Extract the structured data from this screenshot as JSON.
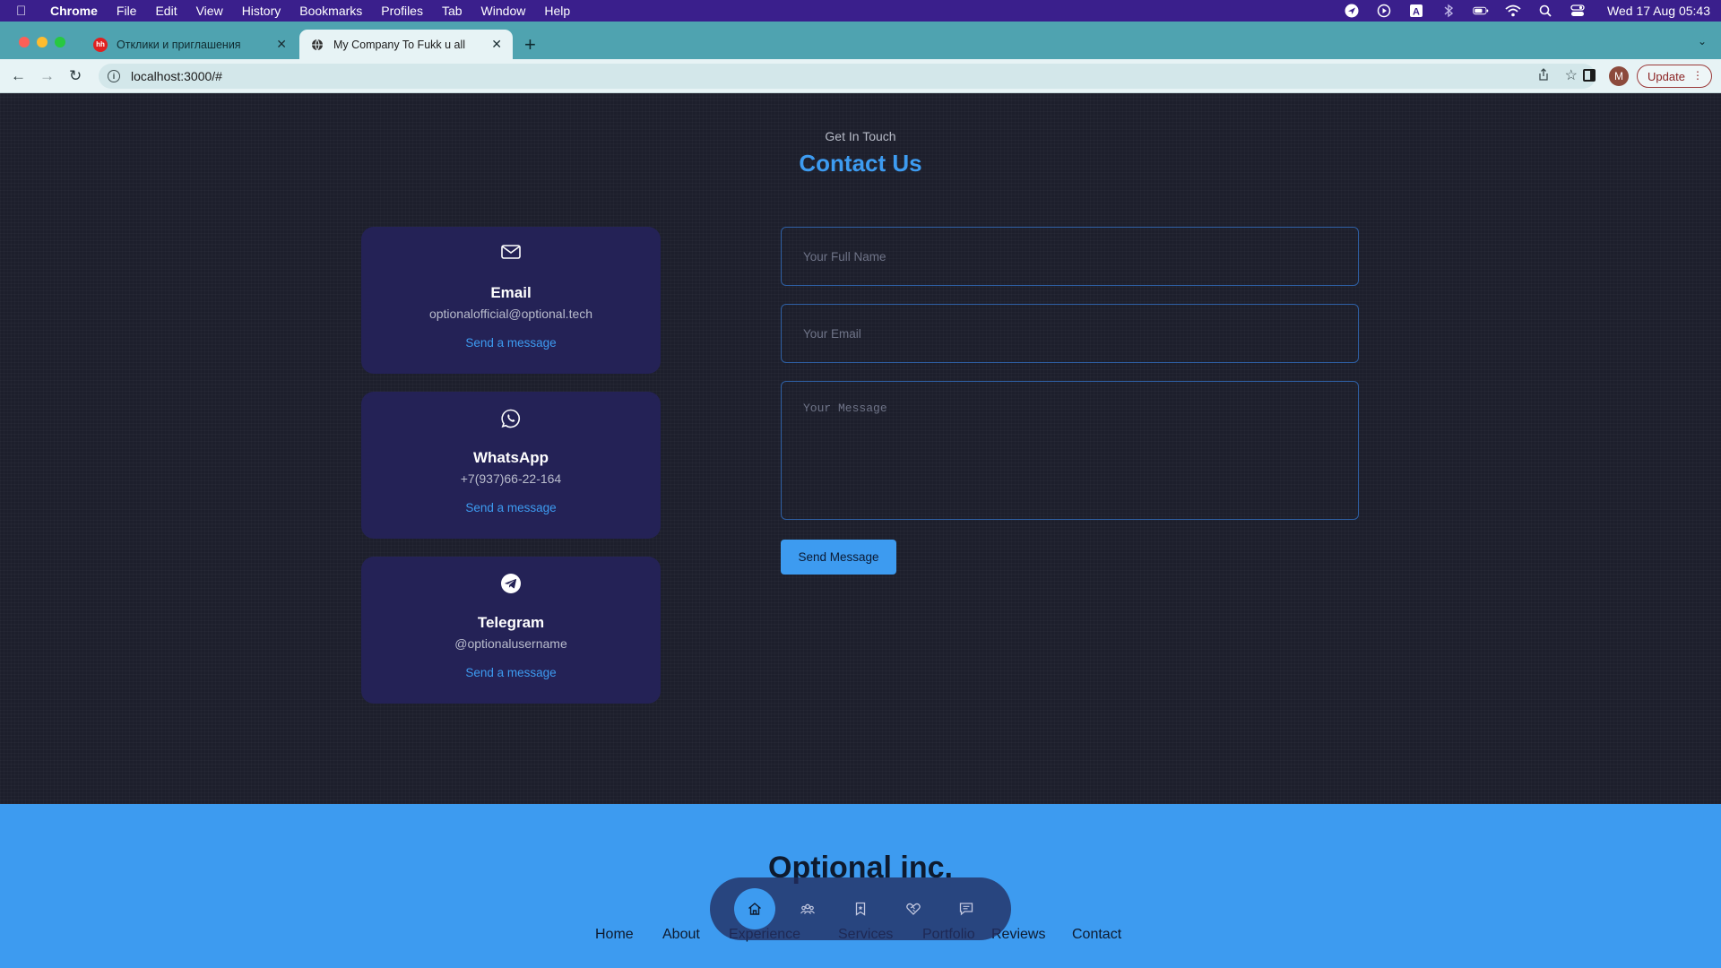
{
  "menubar": {
    "app": "Chrome",
    "items": [
      "File",
      "Edit",
      "View",
      "History",
      "Bookmarks",
      "Profiles",
      "Tab",
      "Window",
      "Help"
    ],
    "clock": "Wed 17 Aug  05:43"
  },
  "tabs": [
    {
      "title": "Отклики и приглашения",
      "favicon_text": "hh",
      "favicon_color": "#e02020"
    },
    {
      "title": "My Company To Fukk u all",
      "active": true
    }
  ],
  "toolbar": {
    "url": "localhost:3000/#",
    "profile_initial": "M",
    "update_label": "Update"
  },
  "contact": {
    "eyebrow": "Get In Touch",
    "title": "Contact Us",
    "cards": [
      {
        "icon": "envelope-icon",
        "title": "Email",
        "value": "optionalofficial@optional.tech",
        "link": "Send a message"
      },
      {
        "icon": "whatsapp-icon",
        "title": "WhatsApp",
        "value": "+7(937)66-22-164",
        "link": "Send a message"
      },
      {
        "icon": "telegram-icon",
        "title": "Telegram",
        "value": "@optionalusername",
        "link": "Send a message"
      }
    ],
    "form": {
      "name_placeholder": "Your Full Name",
      "email_placeholder": "Your Email",
      "message_placeholder": "Your Message",
      "submit_label": "Send Message"
    }
  },
  "footer": {
    "brand": "Optional inc.",
    "links": [
      "Home",
      "About",
      "Experience",
      "Services",
      "Portfolio",
      "Reviews",
      "Contact"
    ]
  },
  "dock": {
    "icons": [
      "home-icon",
      "users-icon",
      "bookmark-icon",
      "handshake-icon",
      "message-icon"
    ],
    "active": "home-icon"
  },
  "colors": {
    "accent": "#3d9bf0",
    "card_bg": "#242256",
    "page_bg": "#1d1f2c",
    "menubar_bg": "#3a1f8c",
    "tabstrip_bg": "#4fa3b0"
  }
}
